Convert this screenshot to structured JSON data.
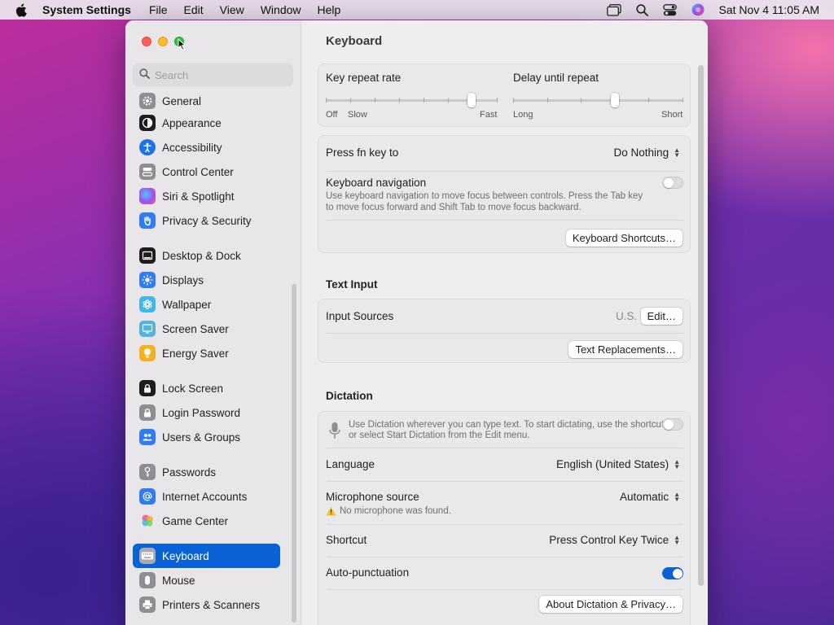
{
  "menubar": {
    "app_name": "System Settings",
    "menus": [
      "File",
      "Edit",
      "View",
      "Window",
      "Help"
    ],
    "clock": "Sat Nov 4  11:05 AM",
    "icons": [
      "apple-icon",
      "window-icon",
      "search-icon",
      "control-center-icon",
      "siri-icon"
    ]
  },
  "sidebar": {
    "search_placeholder": "Search",
    "items": [
      {
        "label": "General",
        "icon": "gear-icon",
        "color": "#8e8e93"
      },
      {
        "label": "Appearance",
        "icon": "appearance-icon",
        "color": "#1d1d1f"
      },
      {
        "label": "Accessibility",
        "icon": "accessibility-icon",
        "color": "#1a73e8"
      },
      {
        "label": "Control Center",
        "icon": "control-center-icon",
        "color": "#8e8e93"
      },
      {
        "label": "Siri & Spotlight",
        "icon": "siri-icon",
        "color": "#7b3fe4"
      },
      {
        "label": "Privacy & Security",
        "icon": "hand-icon",
        "color": "#2f7cf6"
      },
      {
        "label": "Desktop & Dock",
        "icon": "dock-icon",
        "color": "#1d1d1f"
      },
      {
        "label": "Displays",
        "icon": "sun-icon",
        "color": "#2f7cf6"
      },
      {
        "label": "Wallpaper",
        "icon": "flower-icon",
        "color": "#3fb8e8"
      },
      {
        "label": "Screen Saver",
        "icon": "screen-saver-icon",
        "color": "#4fb4e0"
      },
      {
        "label": "Energy Saver",
        "icon": "bulb-icon",
        "color": "#f5b120"
      },
      {
        "label": "Lock Screen",
        "icon": "lock-icon",
        "color": "#1d1d1f"
      },
      {
        "label": "Login Password",
        "icon": "lock-icon",
        "color": "#8e8e93"
      },
      {
        "label": "Users & Groups",
        "icon": "users-icon",
        "color": "#2f7cf6"
      },
      {
        "label": "Passwords",
        "icon": "key-icon",
        "color": "#8e8e93"
      },
      {
        "label": "Internet Accounts",
        "icon": "at-icon",
        "color": "#2f7cf6"
      },
      {
        "label": "Game Center",
        "icon": "game-center-icon",
        "color": "#e85d9c"
      },
      {
        "label": "Keyboard",
        "icon": "keyboard-icon",
        "color": "#8e8e93"
      },
      {
        "label": "Mouse",
        "icon": "mouse-icon",
        "color": "#8e8e93"
      },
      {
        "label": "Printers & Scanners",
        "icon": "printer-icon",
        "color": "#8e8e93"
      }
    ],
    "active": "Keyboard"
  },
  "main": {
    "title": "Keyboard",
    "key_repeat": {
      "label": "Key repeat rate",
      "caps": [
        "Off",
        "Slow",
        "Fast"
      ],
      "level": 0.85
    },
    "delay_repeat": {
      "label": "Delay until repeat",
      "caps": [
        "Long",
        "Short"
      ],
      "level": 0.6
    },
    "fn_key": {
      "label": "Press fn key to",
      "value": "Do Nothing"
    },
    "keyboard_nav": {
      "label": "Keyboard navigation",
      "desc_line1": "Use keyboard navigation to move focus between controls. Press the Tab key",
      "desc_line2": "to move focus forward and Shift Tab to move focus backward.",
      "enabled": false
    },
    "keyboard_shortcuts_button": "Keyboard Shortcuts…",
    "text_input": {
      "title": "Text Input",
      "input_sources_label": "Input Sources",
      "input_sources_value": "U.S.",
      "edit_button": "Edit…",
      "text_replacements_button": "Text Replacements…"
    },
    "dictation": {
      "title": "Dictation",
      "desc_line1": "Use Dictation wherever you can type text. To start dictating, use the shortcut",
      "desc_line2": "or select Start Dictation from the Edit menu.",
      "enabled": false,
      "language_label": "Language",
      "language_value": "English (United States)",
      "mic_label": "Microphone source",
      "mic_value": "Automatic",
      "mic_warning": "No microphone was found.",
      "shortcut_label": "Shortcut",
      "shortcut_value": "Press Control Key Twice",
      "autopunct_label": "Auto-punctuation",
      "autopunct_enabled": true,
      "about_button": "About Dictation & Privacy…"
    }
  }
}
